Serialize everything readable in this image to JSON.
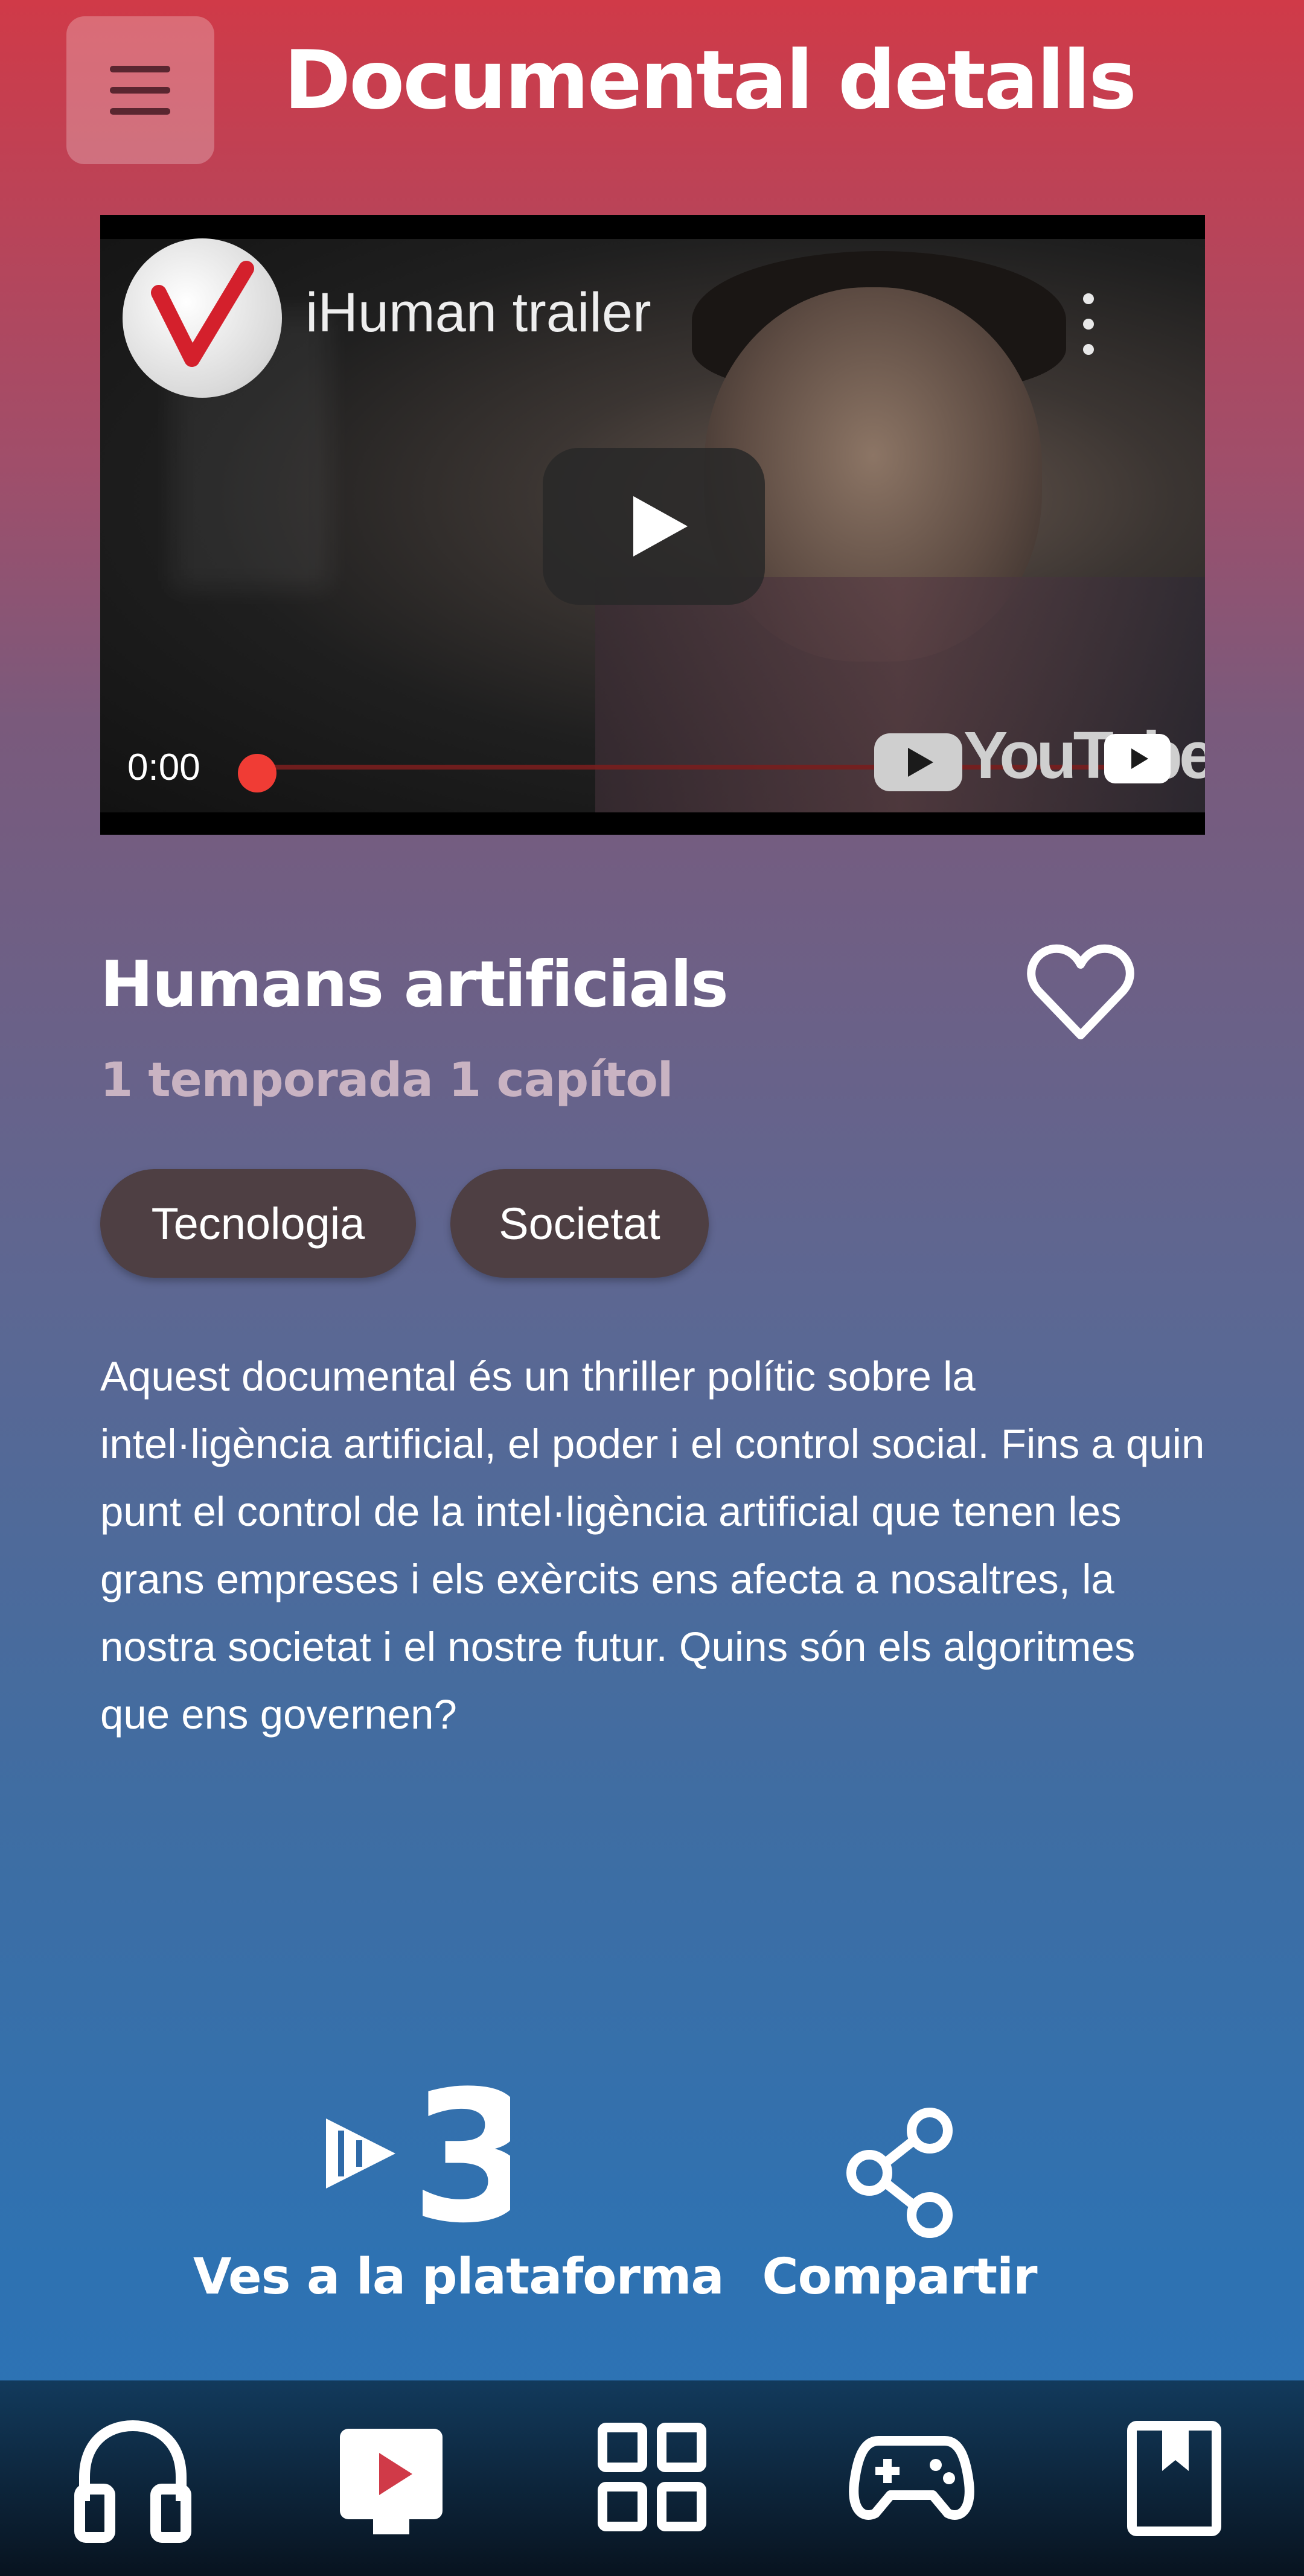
{
  "header": {
    "title": "Documental detalls",
    "menu_icon": "hamburger-menu-icon"
  },
  "video": {
    "title": "iHuman trailer",
    "time": "0:00",
    "progress": 0,
    "brand_text": "YouTube",
    "icons": [
      "channel-avatar",
      "more-options-icon",
      "play-icon",
      "youtube-logo",
      "fullscreen-youtube-icon"
    ]
  },
  "show": {
    "title": "Humans artificials",
    "subtitle": "1 temporada 1 capítol",
    "favorite_icon": "heart-outline-icon",
    "tags": [
      "Tecnologia",
      "Societat"
    ],
    "description": "Aquest documental és un thriller polític sobre la intel·ligència artificial, el poder i el control social. Fins a quin punt el control de la intel·ligència artificial que tenen les grans empreses i els exèrcits ens afecta a nosaltres, la nostra societat i el nostre futur. Quins són els algoritmes que ens governen?"
  },
  "actions": {
    "platform_label": "Ves a la plataforma",
    "platform_icon": "tv3-logo",
    "share_label": "Compartir",
    "share_icon": "share-icon"
  },
  "bottom_nav": {
    "items": [
      {
        "icon": "headphones-icon",
        "active": false
      },
      {
        "icon": "video-play-icon",
        "active": true
      },
      {
        "icon": "grid-icon",
        "active": false
      },
      {
        "icon": "gamepad-icon",
        "active": false
      },
      {
        "icon": "bookmark-book-icon",
        "active": false
      }
    ]
  },
  "colors": {
    "accent_red": "#d03a48",
    "accent_blue": "#2b74b8",
    "tag_bg": "#4e3f43"
  }
}
